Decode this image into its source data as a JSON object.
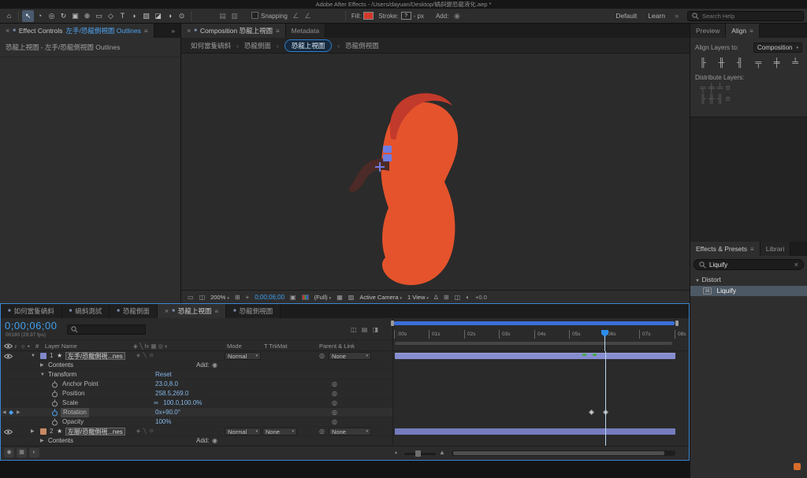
{
  "colors": {
    "accent_blue": "#3d85d1",
    "timecode_blue": "#3fa0f0",
    "value_blue": "#85b7ea",
    "layer_bar": "#7a82c4",
    "dino_body": "#e5532c",
    "dino_crest": "#c23a2b",
    "dino_arm": "#4c2a27",
    "fill_red": "#d2392b",
    "keyframe_green": "#4aa84e"
  },
  "title_bar": {
    "title": "Adobe After Effects - /Users/dayuan/Desktop/蝸斜變恐龍液化.aep *"
  },
  "toolbar": {
    "tools": {
      "home": "⌂",
      "selection": "↖",
      "hand": "◔",
      "zoom": "◎",
      "orbit": "↻",
      "camera": "▣",
      "pan_behind": "⊕",
      "shape": "▭",
      "pen": "◇",
      "type": "T",
      "brush": "◗",
      "clone_stamp": "▨",
      "eraser": "◪",
      "roto_brush": "◑",
      "puppet": "⊙"
    },
    "snapping_label": "Snapping",
    "fill_label": "Fill:",
    "stroke_label": "Stroke:",
    "stroke_value": "?",
    "stroke_width": "- px",
    "add_label": "Add:",
    "workspace_default": "Default",
    "workspace_learn": "Learn",
    "search_placeholder": "Search Help"
  },
  "icons": {
    "close": "×",
    "menu": "≡",
    "chevrons": "»",
    "dropdown": "▾",
    "crumb_sep": "‹",
    "twirl_open": "▼",
    "twirl_closed": "▶",
    "star": "★",
    "pickwhip": "◎",
    "link": "∞",
    "add_target": "◉",
    "kf_prev": "◀",
    "kf_diamond": "◆",
    "kf_next": "▶",
    "speaker": "♪",
    "solo": "○",
    "lock": "▪",
    "chip": "■",
    "panel_a": "▤",
    "panel_b": "▥",
    "angle": "∠",
    "monitor": "▭",
    "split_view": "◫",
    "mask_view": "◩",
    "grid": "⊞",
    "crosshair": "+",
    "camera_snap": "▣",
    "region": "▦",
    "transp_grid": "▨",
    "cube": "∆",
    "exposure": "◐",
    "switches_header": "◈ ╲ fx ▦ ◎ ◐",
    "layer_switches": "◈ ╲ ⊙",
    "comp_mini": "◫ ▤ ◨",
    "toggle_shy": "◉",
    "toggle_blend": "▦",
    "toggle_motionblur": "◐",
    "zoom_small": "▴",
    "zoom_large": "▲",
    "align_left": "╟",
    "align_hcenter": "╫",
    "align_right": "╢",
    "align_top": "╤",
    "align_vcenter": "╪",
    "align_bottom": "╧",
    "dist_row1": "╤  ╪  ╧  ≡",
    "dist_row2": "╟  ╫  ╢  ≡"
  },
  "effect_controls": {
    "tab_title": "Effect Controls",
    "tab_target": "左手/恐龍側視圖 Outlines",
    "content_line": "恐龍上視圖 - 左手/恐龍側視圖 Outlines"
  },
  "composition": {
    "tab_title": "Composition 恐龍上視圖",
    "metadata_tab": "Metadata",
    "breadcrumbs": [
      "如何當隻蝸斜",
      "恐龍側面",
      "恐龍上視圖",
      "恐龍側視圖"
    ],
    "bar": {
      "zoom": "200%",
      "timecode": "0;00;06;00",
      "resolution": "(Full)",
      "camera": "Active Camera",
      "view": "1 View",
      "exposure": "+0.0"
    }
  },
  "align_panel": {
    "preview_tab": "Preview",
    "align_tab": "Align",
    "align_layers_label": "Align Layers to:",
    "align_target": "Composition",
    "distribute_label": "Distribute Layers:"
  },
  "effects_presets": {
    "tab": "Effects & Presets",
    "libraries_tab": "Librari",
    "search_value": "Liquify",
    "clear": "×",
    "category": "Distort",
    "effect": "Liquify",
    "effect_badge": "16"
  },
  "timeline": {
    "tabs": [
      {
        "label": "如何當隻蝸斜"
      },
      {
        "label": "蝸斜測試"
      },
      {
        "label": "恐龍側面"
      },
      {
        "label": "恐龍上視圖"
      },
      {
        "label": "恐龍側視圖"
      }
    ],
    "timecode": "0;00;06;00",
    "frame_info": "00180 (29.97 fps)",
    "headers": {
      "index": "#",
      "layer_name": "Layer Name",
      "mode": "Mode",
      "trkmat": "T TrkMat",
      "parent": "Parent & Link"
    },
    "ruler_ticks": [
      ":00s",
      "01s",
      "02s",
      "03s",
      "04s",
      "05s",
      "06s",
      "07s",
      "08s"
    ],
    "layers": [
      {
        "num": "1",
        "name": "左手/恐龍側視...nes",
        "mode": "Normal",
        "parent": "None"
      },
      {
        "num": "2",
        "name": "左腳/恐龍側視...nes",
        "mode": "Normal",
        "trkmat": "None",
        "parent": "None"
      }
    ],
    "group_labels": {
      "contents": "Contents",
      "add": "Add:",
      "transform": "Transform",
      "reset": "Reset"
    },
    "props": [
      {
        "label": "Anchor Point",
        "value": "23.0,8.0"
      },
      {
        "label": "Position",
        "value": "258.5,269.0"
      },
      {
        "label": "Scale",
        "value": "100.0,100.0%"
      },
      {
        "label": "Rotation",
        "value": "0x+90.0°"
      },
      {
        "label": "Opacity",
        "value": "100%"
      }
    ]
  }
}
